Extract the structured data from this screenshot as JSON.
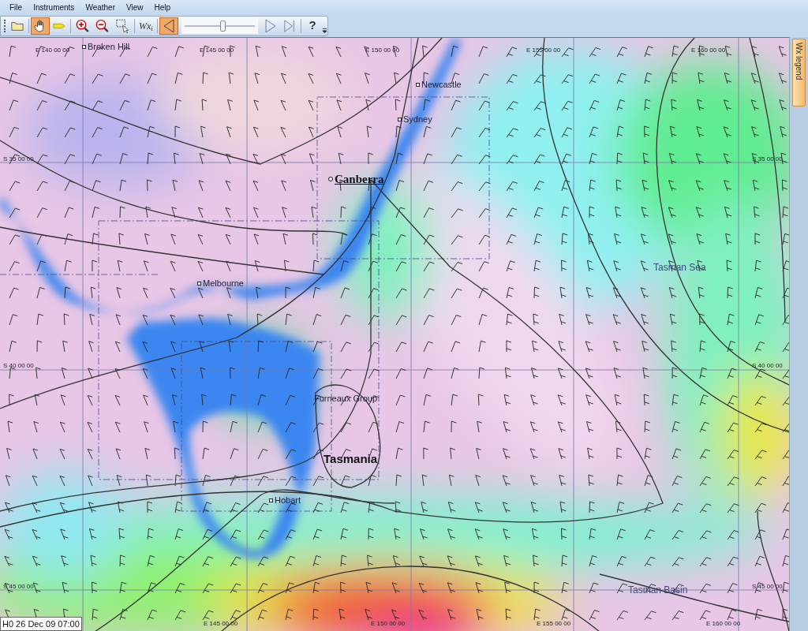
{
  "menu": [
    {
      "label": "File"
    },
    {
      "label": "Instruments"
    },
    {
      "label": "Weather"
    },
    {
      "label": "View"
    },
    {
      "label": "Help"
    }
  ],
  "toolbar": [
    {
      "kind": "folder",
      "selected": false
    },
    {
      "kind": "hand",
      "selected": true
    },
    {
      "kind": "pointer",
      "selected": false
    },
    {
      "kind": "zoom-in",
      "selected": false
    },
    {
      "kind": "zoom-out",
      "selected": false
    },
    {
      "kind": "select",
      "selected": false
    },
    {
      "kind": "text",
      "label": "Wx$_{i}$",
      "selected": false
    },
    {
      "kind": "back",
      "selected": true
    },
    {
      "kind": "slider",
      "level": 0.55
    },
    {
      "kind": "play",
      "selected": false
    },
    {
      "kind": "end",
      "selected": false
    },
    {
      "kind": "help",
      "label": "?",
      "selected": false
    }
  ],
  "map": {
    "places": [
      {
        "kind": "town",
        "label": "Broken Hill"
      },
      {
        "kind": "town",
        "label": "Newcastle"
      },
      {
        "kind": "town",
        "label": "Sydney"
      },
      {
        "kind": "capital",
        "label": "Canberra"
      },
      {
        "kind": "town",
        "label": "Melbourne"
      },
      {
        "kind": "region",
        "label": "Furneaux Group"
      },
      {
        "kind": "island",
        "label": "Tasmania"
      },
      {
        "kind": "town",
        "label": "Hobart"
      },
      {
        "kind": "sea",
        "label": "Tasman Sea"
      },
      {
        "kind": "sea",
        "label": "Tasman Basin"
      }
    ],
    "grid_labels": [
      {
        "label": "E 140 00 00"
      },
      {
        "label": "E 145 00 00"
      },
      {
        "label": "E 150 00 00"
      },
      {
        "label": "E 155 00 00"
      },
      {
        "label": "E 160 00 00"
      },
      {
        "label": "S 35 00 00"
      },
      {
        "label": "S 35 00 00"
      },
      {
        "label": "S 40 00 00"
      },
      {
        "label": "S 40 00 00"
      },
      {
        "label": "S 45 00 00"
      },
      {
        "label": "S 45 00 00"
      },
      {
        "label": "E 145 00 00"
      },
      {
        "label": "E 150 00 00"
      },
      {
        "label": "E 155 00 00"
      },
      {
        "label": "E 160 00 00"
      }
    ],
    "side_tab": "Wx legend"
  },
  "status_bar": {
    "time": "H0 26 Dec 09 07:00"
  }
}
